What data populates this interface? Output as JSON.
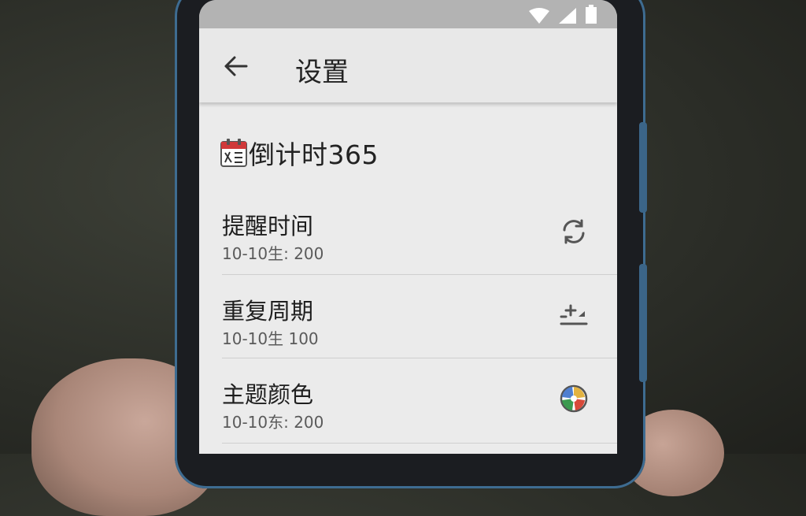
{
  "status_bar": {
    "icons": [
      "wifi-icon",
      "cell-signal-icon",
      "battery-icon"
    ]
  },
  "app_bar": {
    "back_icon": "arrow-left-icon",
    "title": "设置"
  },
  "section": {
    "icon": "calendar-icon",
    "title": "倒计时365"
  },
  "preferences": [
    {
      "title": "提醒时间",
      "subtitle": "10-10生: 200",
      "icon": "sync-icon"
    },
    {
      "title": "重复周期",
      "subtitle": "10-10生 100",
      "icon": "add-list-icon"
    },
    {
      "title": "主题颜色",
      "subtitle": "10-10东: 200",
      "icon": "color-palette-icon"
    }
  ],
  "colors": {
    "status_bar": "#b3b3b3",
    "app_bar": "#e8e8e8",
    "screen_bg": "#ebebeb",
    "phone_frame_accent": "#3e6c91"
  }
}
